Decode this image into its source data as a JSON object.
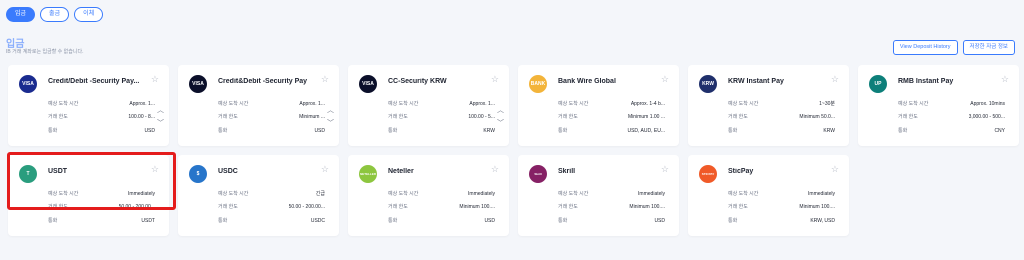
{
  "tabs": [
    {
      "label": "입금",
      "active": true
    },
    {
      "label": "출금",
      "active": false
    },
    {
      "label": "이체",
      "active": false
    }
  ],
  "section": {
    "title": "입금",
    "subtitle": "IB 거래 계좌로는 입금할 수 없습니다."
  },
  "buttons": {
    "view_history": "View Deposit History",
    "saved_info": "저장한 자금 정보"
  },
  "cards": [
    {
      "name": "Credit/Debit -Security Pay...",
      "logo": "VISA",
      "logo_color": "#1a2b8f",
      "rows": [
        {
          "label": "예상 도착 시간",
          "value": "Approx. 1..."
        },
        {
          "label": "거래 한도",
          "value": "100.00 - 8..."
        },
        {
          "label": "통화",
          "value": "USD"
        }
      ]
    },
    {
      "name": "Credit&Debit -Security Pay",
      "logo": "VISA",
      "logo_color": "#0b0f2a",
      "rows": [
        {
          "label": "예상 도착 시간",
          "value": "Approx. 1..."
        },
        {
          "label": "거래 한도",
          "value": "Minimum ..."
        },
        {
          "label": "통화",
          "value": "USD"
        }
      ]
    },
    {
      "name": "CC-Security KRW",
      "logo": "VISA",
      "logo_color": "#0b0f2a",
      "rows": [
        {
          "label": "예상 도착 시간",
          "value": "Approx. 1..."
        },
        {
          "label": "거래 한도",
          "value": "100.00 - 5..."
        },
        {
          "label": "통화",
          "value": "KRW"
        }
      ]
    },
    {
      "name": "Bank Wire Global",
      "logo": "BANK",
      "logo_color": "#f3b43a",
      "rows": [
        {
          "label": "예상 도착 시간",
          "value": "Approx. 1-4 b..."
        },
        {
          "label": "거래 한도",
          "value": "Minimum 1.00 ..."
        },
        {
          "label": "통화",
          "value": "USD, AUD, EU..."
        }
      ]
    },
    {
      "name": "KRW Instant Pay",
      "logo": "KRW",
      "logo_color": "#1f2f6b",
      "rows": [
        {
          "label": "예상 도착 시간",
          "value": "1~30분"
        },
        {
          "label": "거래 한도",
          "value": "Minimum 50.0..."
        },
        {
          "label": "통화",
          "value": "KRW"
        }
      ]
    },
    {
      "name": "RMB Instant Pay",
      "logo": "UP",
      "logo_color": "#0d7f7a",
      "rows": [
        {
          "label": "예상 도착 시간",
          "value": "Approx. 10mins"
        },
        {
          "label": "거래 한도",
          "value": "3,000.00 - 500..."
        },
        {
          "label": "통화",
          "value": "CNY"
        }
      ]
    },
    {
      "name": "USDT",
      "logo": "T",
      "logo_color": "#2a9d7e",
      "rows": [
        {
          "label": "예상 도착 시간",
          "value": "Immediately"
        },
        {
          "label": "거래 한도",
          "value": "50.00 - 200.00..."
        },
        {
          "label": "통화",
          "value": "USDT"
        }
      ]
    },
    {
      "name": "USDC",
      "logo": "$",
      "logo_color": "#2775ca",
      "rows": [
        {
          "label": "예상 도착 시간",
          "value": "긴급"
        },
        {
          "label": "거래 한도",
          "value": "50.00 - 200.00..."
        },
        {
          "label": "통화",
          "value": "USDC"
        }
      ]
    },
    {
      "name": "Neteller",
      "logo": "NETELLER",
      "logo_color": "#8dc63f",
      "rows": [
        {
          "label": "예상 도착 시간",
          "value": "Immediately"
        },
        {
          "label": "거래 한도",
          "value": "Minimum 100...."
        },
        {
          "label": "통화",
          "value": "USD"
        }
      ]
    },
    {
      "name": "Skrill",
      "logo": "Skrill",
      "logo_color": "#862165",
      "rows": [
        {
          "label": "예상 도착 시간",
          "value": "Immediately"
        },
        {
          "label": "거래 한도",
          "value": "Minimum 100...."
        },
        {
          "label": "통화",
          "value": "USD"
        }
      ]
    },
    {
      "name": "SticPay",
      "logo": "STICPAY",
      "logo_color": "#f05a28",
      "rows": [
        {
          "label": "예상 도착 시간",
          "value": "Immediately"
        },
        {
          "label": "거래 한도",
          "value": "Minimum 100...."
        },
        {
          "label": "통화",
          "value": "KRW, USD"
        }
      ]
    }
  ]
}
